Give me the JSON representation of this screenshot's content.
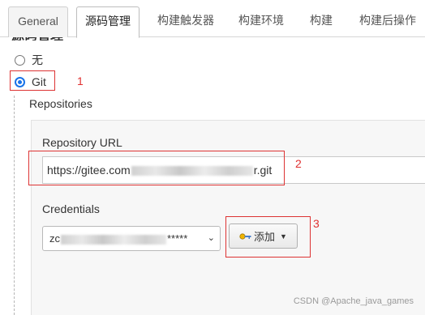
{
  "tabs": [
    {
      "label": "General",
      "active": false
    },
    {
      "label": "源码管理",
      "active": true
    },
    {
      "label": "构建触发器",
      "active": false
    },
    {
      "label": "构建环境",
      "active": false
    },
    {
      "label": "构建",
      "active": false
    },
    {
      "label": "构建后操作",
      "active": false
    }
  ],
  "scm": {
    "options": [
      {
        "label": "无",
        "selected": false
      },
      {
        "label": "Git",
        "selected": true
      }
    ]
  },
  "repositories": {
    "title": "Repositories",
    "url_label": "Repository URL",
    "url_prefix": "https://gitee.com",
    "url_suffix": "r.git",
    "credentials_label": "Credentials",
    "credentials_prefix": "zc",
    "credentials_mask": "*****",
    "add_button_label": "添加"
  },
  "annotations": [
    "1",
    "2",
    "3"
  ],
  "watermark": "CSDN @Apache_java_games",
  "colors": {
    "annotation": "#e03030",
    "radio_selected": "#1a73e8"
  }
}
